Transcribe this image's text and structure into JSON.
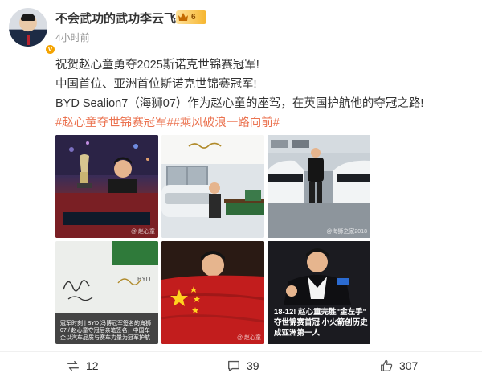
{
  "post": {
    "author": "不会武功的武功李云飞",
    "vip_level": "6",
    "time": "4小时前",
    "lines": [
      "祝贺赵心童勇夺2025斯诺克世锦赛冠军!",
      "中国首位、亚洲首位斯诺克世锦赛冠军!",
      "BYD Sealion7（海狮07）作为赵心童的座驾，在英国护航他的夺冠之路!"
    ],
    "hashtags": [
      "#赵心童夺世锦赛冠军#",
      "#乘风破浪一路向前#"
    ]
  },
  "photos": [
    {
      "name": "photo-trophy",
      "watermark": "@ 赵心童"
    },
    {
      "name": "photo-snooker-room",
      "watermark": ""
    },
    {
      "name": "photo-cars",
      "watermark": "@海狮之家2018"
    },
    {
      "name": "photo-signature",
      "caption": "冠军时刻 | BYD 冯博冠军签名的海狮07 / 赵心童夺冠后亲笔签名，中国车企以汽车品质与赛车力量为冠军护航",
      "watermark": ""
    },
    {
      "name": "photo-flag",
      "watermark": "@ 赵心童"
    },
    {
      "name": "photo-player",
      "caption": "18-12! 赵心童完胜\"金左手\" 夺世锦赛首冠 小火箭创历史成亚洲第一人",
      "watermark": ""
    }
  ],
  "actions": {
    "repost_count": "12",
    "comment_count": "39",
    "like_count": "307"
  },
  "colors": {
    "hashtag": "#eb7350",
    "verified": "#f4a300",
    "text": "#333333",
    "muted": "#939393"
  }
}
